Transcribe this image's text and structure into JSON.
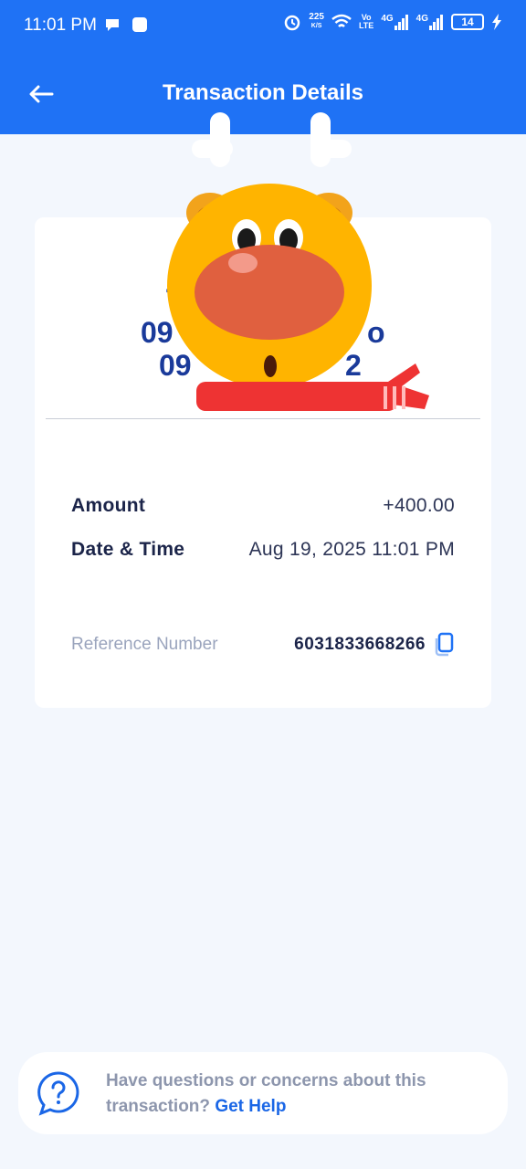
{
  "status_bar": {
    "time": "11:01 PM",
    "network_speed_value": "225",
    "network_speed_unit": "K/S",
    "volte_top": "Vo",
    "volte_bottom": "LTE",
    "sim1_label": "4G",
    "sim2_label": "4G",
    "battery_level": "14"
  },
  "header": {
    "title": "Transaction Details"
  },
  "card": {
    "partial_line1": "T",
    "partial_line2_left": "09",
    "partial_line2_right": "o",
    "partial_line3_left": "09",
    "partial_line3_right": "2"
  },
  "details": {
    "amount_label": "Amount",
    "amount_value": "+400.00",
    "datetime_label": "Date & Time",
    "datetime_value": "Aug 19, 2025 11:01 PM",
    "reference_label": "Reference Number",
    "reference_value": "6031833668266"
  },
  "help": {
    "text": "Have questions or concerns about this transaction?",
    "link_label": "Get Help"
  },
  "colors": {
    "header_blue": "#1f72f5",
    "link_blue": "#1a66e6",
    "background": "#f3f7fd"
  }
}
